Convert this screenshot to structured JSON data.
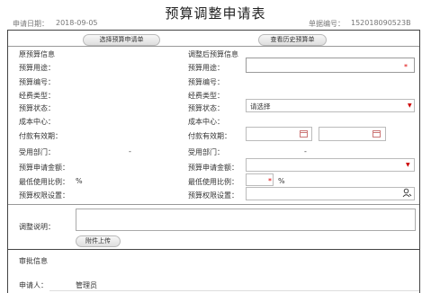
{
  "header": {
    "title": "预算调整申请表",
    "date_label": "申请日期：",
    "date_value": "2018-09-05",
    "no_label": "单据编号：",
    "no_value": "152018090523B"
  },
  "buttons": {
    "select_original": "选择预算申请单",
    "view_history": "查看历史预算单",
    "attach_upload": "附件上传"
  },
  "left": {
    "section": "原预算信息",
    "purpose": "预算用途：",
    "code": "预算编号：",
    "fund_type": "经费类型：",
    "status": "预算状态：",
    "cost_center": "成本中心：",
    "pay_period": "付款有效期：",
    "applicant_dept": "受用部门：",
    "dash": "-",
    "apply_amount": "预算申请金额：",
    "min_use_ratio": "最低使用比例：",
    "percent": "%",
    "permission": "预算权限设置："
  },
  "right": {
    "section": "调整后预算信息",
    "purpose": "预算用途：",
    "code": "预算编号：",
    "fund_type": "经费类型：",
    "status": "预算状态：",
    "status_value": "请选择",
    "cost_center": "成本中心：",
    "pay_period": "付款有效期：",
    "applicant_dept": "受用部门：",
    "dash": "-",
    "apply_amount": "预算申请金额：",
    "min_use_ratio": "最低使用比例：",
    "percent": "%",
    "permission": "预算权限设置："
  },
  "reason": {
    "label": "调整说明："
  },
  "approval": {
    "section": "审批信息",
    "applicant_label": "申请人：",
    "applicant_value": "管理员"
  },
  "colors": {
    "required": "#dd0000",
    "border": "#444444"
  }
}
